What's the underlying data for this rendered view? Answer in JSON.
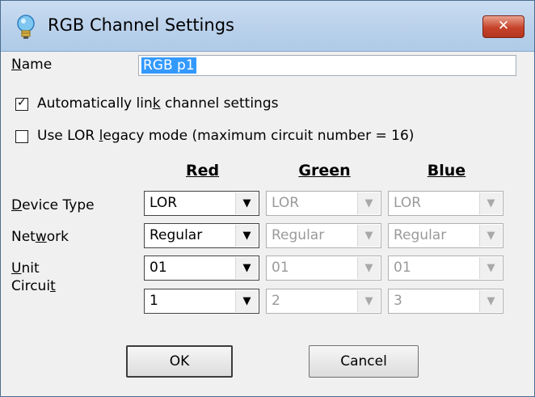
{
  "window": {
    "title": "RGB Channel Settings",
    "close_label": "✕"
  },
  "name": {
    "label": "Name",
    "value": "RGB p1"
  },
  "checkboxes": {
    "auto_link": {
      "label": "Automatically link channel settings",
      "checked": true
    },
    "legacy": {
      "label": "Use LOR legacy mode (maximum circuit number = 16)",
      "checked": false
    }
  },
  "columns": [
    "Red",
    "Green",
    "Blue"
  ],
  "rows": {
    "device_type": {
      "label": "Device Type",
      "values": [
        "LOR",
        "LOR",
        "LOR"
      ]
    },
    "network": {
      "label": "Network",
      "values": [
        "Regular",
        "Regular",
        "Regular"
      ]
    },
    "unit": {
      "label": "Unit",
      "values": [
        "01",
        "01",
        "01"
      ]
    },
    "circuit": {
      "label": "Circuit",
      "values": [
        "1",
        "2",
        "3"
      ]
    }
  },
  "buttons": {
    "ok": "OK",
    "cancel": "Cancel"
  },
  "colors": {
    "titlebar": "#b9d0ea",
    "close": "#c7432a",
    "selection": "#3399ff",
    "disabled_text": "#9a9a9a"
  }
}
